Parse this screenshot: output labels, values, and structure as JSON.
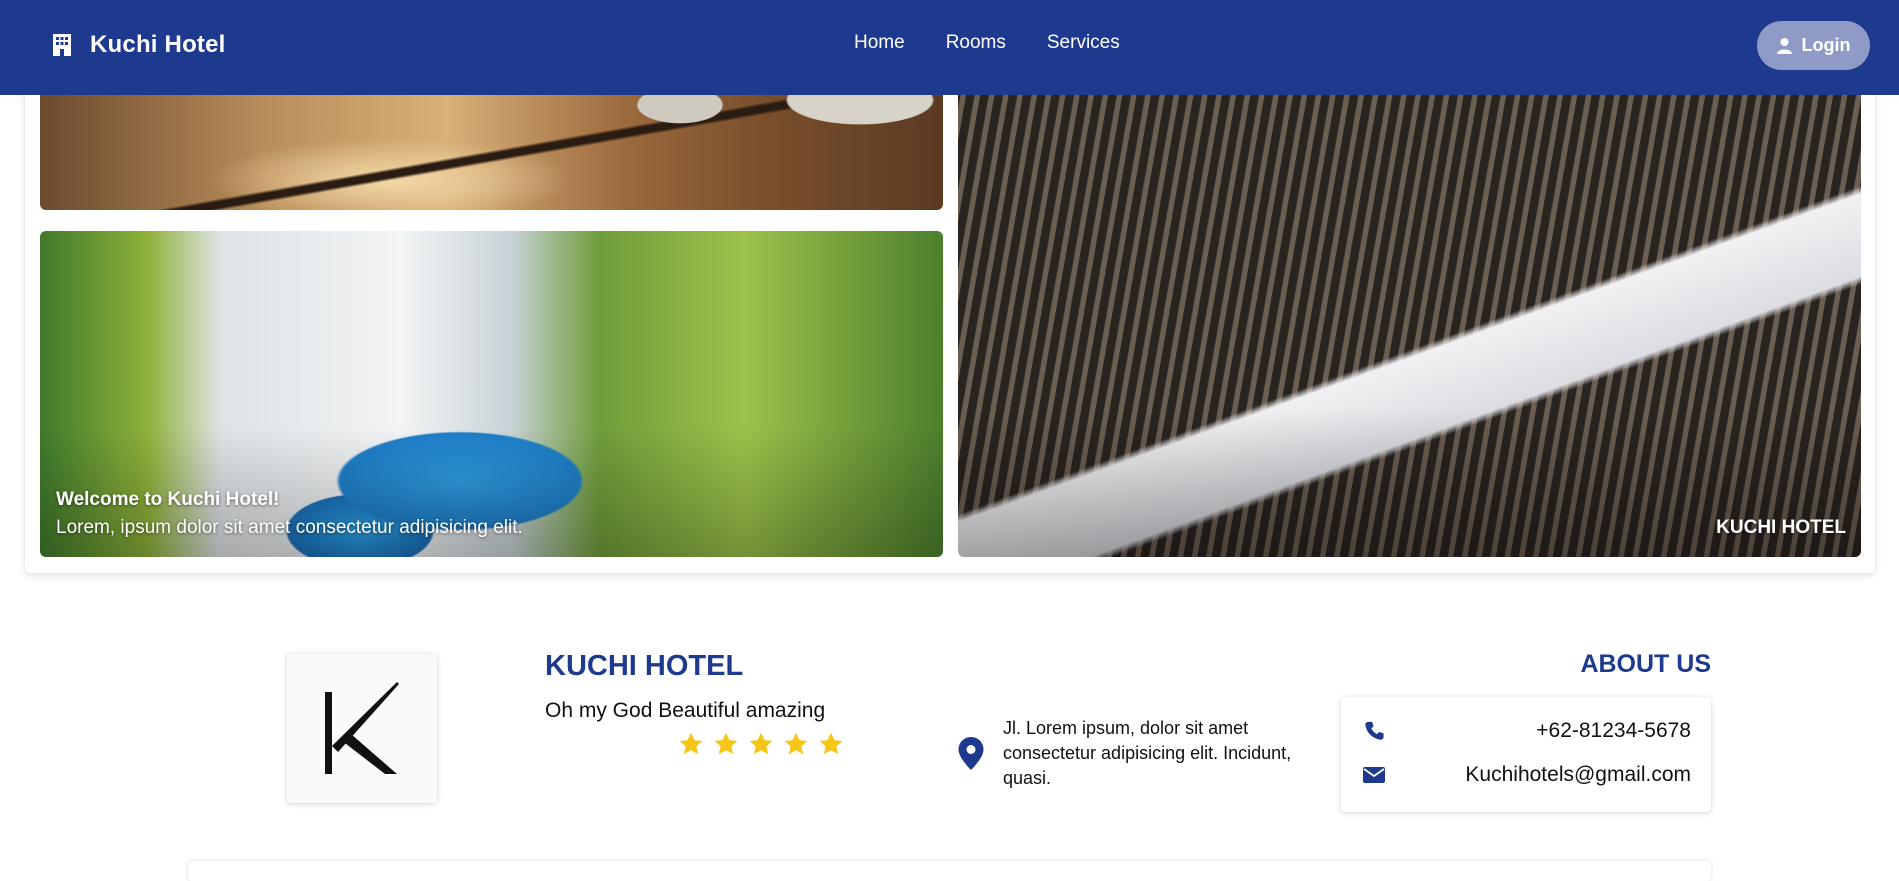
{
  "navbar": {
    "brand": "Kuchi Hotel",
    "brand_icon": "hotel-building-icon",
    "links": [
      "Home",
      "Rooms",
      "Services"
    ],
    "login_label": "Login",
    "login_icon": "user-icon",
    "bg_color": "#1e3a8f"
  },
  "gallery": {
    "pool_title": "Welcome to Kuchi Hotel!",
    "pool_subtitle": "Lorem, ipsum dolor sit amet consectetur adipisicing elit.",
    "room_caption": "KUCHI HOTEL"
  },
  "info": {
    "logo_letter": "K",
    "hotel_name": "KUCHI HOTEL",
    "tagline": "Oh my God Beautiful amazing",
    "rating": 5,
    "star_color": "#f5c518",
    "address_icon": "map-pin-icon",
    "address": "Jl. Lorem ipsum, dolor sit amet consectetur adipisicing elit. Incidunt, quasi."
  },
  "about": {
    "title": "ABOUT US",
    "phone_icon": "phone-icon",
    "phone": "+62-81234-5678",
    "email_icon": "envelope-icon",
    "email": "Kuchihotels@gmail.com"
  }
}
